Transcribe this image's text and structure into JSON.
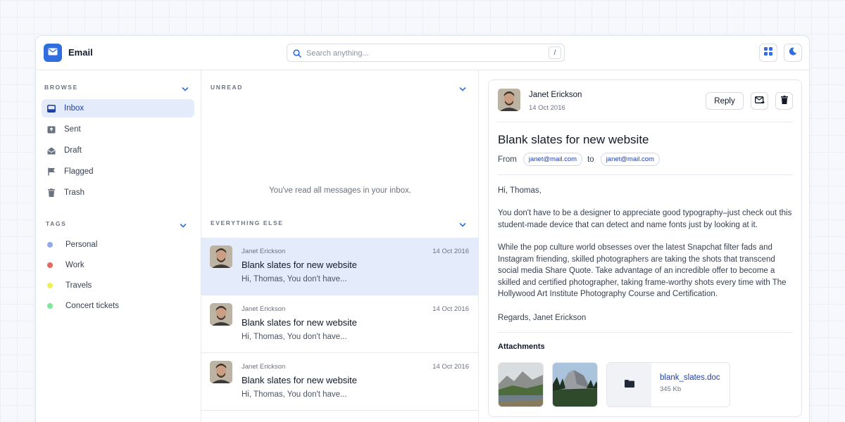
{
  "header": {
    "app_title": "Email",
    "search_placeholder": "Search anything...",
    "search_shortcut": "/",
    "accent_color": "#2f6de1"
  },
  "sidebar": {
    "browse_label": "BROWSE",
    "nav": [
      {
        "label": "Inbox",
        "icon": "inbox-icon",
        "active": true
      },
      {
        "label": "Sent",
        "icon": "sent-icon",
        "active": false
      },
      {
        "label": "Draft",
        "icon": "draft-icon",
        "active": false
      },
      {
        "label": "Flagged",
        "icon": "flag-icon",
        "active": false
      },
      {
        "label": "Trash",
        "icon": "trash-icon",
        "active": false
      }
    ],
    "tags_label": "TAGS",
    "tags": [
      {
        "label": "Personal",
        "color": "#93a9ef"
      },
      {
        "label": "Work",
        "color": "#e56a5f"
      },
      {
        "label": "Travels",
        "color": "#eef05a"
      },
      {
        "label": "Concert tickets",
        "color": "#7ee89a"
      }
    ]
  },
  "list": {
    "unread_label": "UNREAD",
    "empty_message": "You've read all messages in your inbox.",
    "everything_else_label": "EVERYTHING ELSE",
    "messages": [
      {
        "sender": "Janet Erickson",
        "date": "14 Oct 2016",
        "subject": "Blank slates for new website",
        "preview": "Hi, Thomas, You don't have..."
      },
      {
        "sender": "Janet Erickson",
        "date": "14 Oct 2016",
        "subject": "Blank slates for new website",
        "preview": "Hi, Thomas, You don't have..."
      },
      {
        "sender": "Janet Erickson",
        "date": "14 Oct 2016",
        "subject": "Blank slates for new website",
        "preview": "Hi, Thomas, You don't have..."
      }
    ]
  },
  "reader": {
    "sender": "Janet Erickson",
    "date": "14 Oct 2016",
    "reply_label": "Reply",
    "subject": "Blank slates for new website",
    "from_label": "From",
    "from_email": "janet@mail.com",
    "to_label": "to",
    "to_email": "janet@mail.com",
    "greeting": "Hi, Thomas,",
    "paragraph1": "You don't have to be a designer to appreciate good typography–just check out this student-made device that can detect and name fonts just by looking at it.",
    "paragraph2": "While the pop culture world obsesses over the latest Snapchat filter fads and Instagram friending, skilled photographers are taking the shots that transcend social media Share Quote. Take advantage of an incredible offer to become a skilled and certified photographer, taking frame-worthy shots every time with The Hollywood Art Institute Photography Course and Certification.",
    "signoff": "Regards, Janet Erickson",
    "attachments_label": "Attachments",
    "file_name": "blank_slates.doc",
    "file_size": "345 Kb"
  }
}
